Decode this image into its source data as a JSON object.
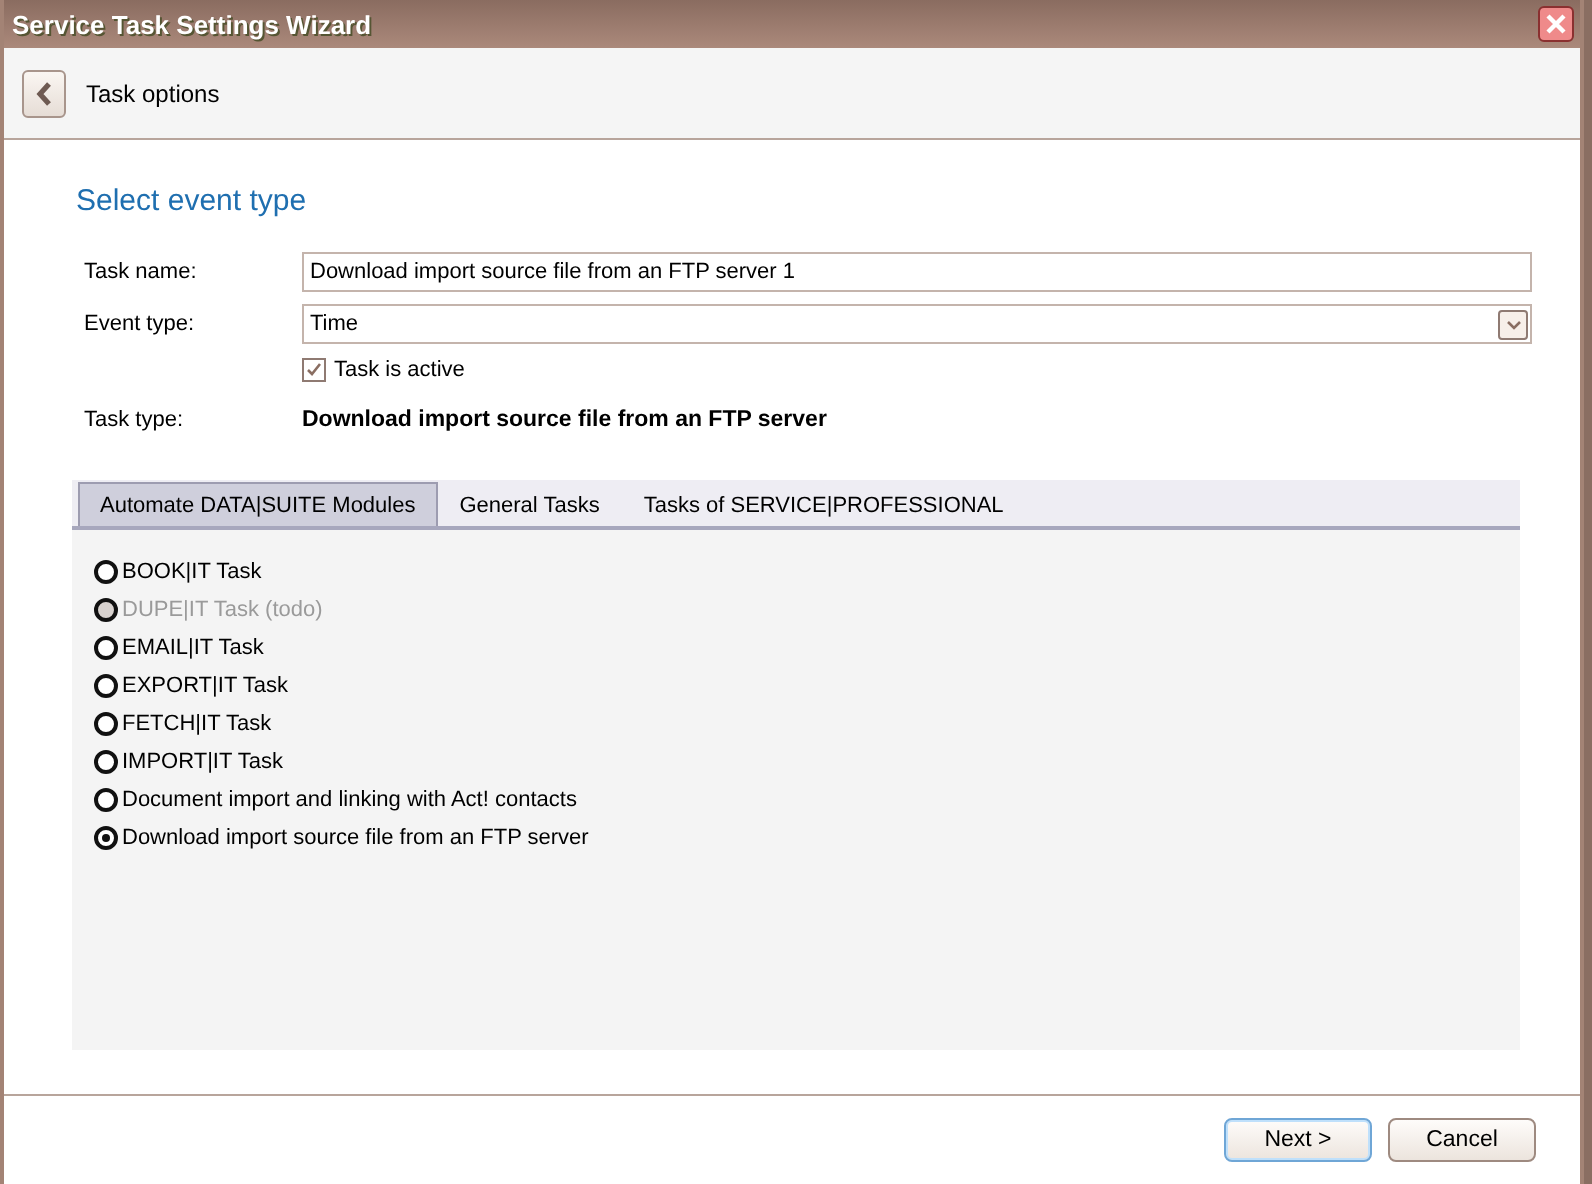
{
  "window": {
    "title": "Service Task Settings Wizard"
  },
  "header": {
    "title": "Task options"
  },
  "heading": "Select event type",
  "form": {
    "task_name": {
      "label": "Task name:",
      "value": "Download import source file from an FTP server 1"
    },
    "event_type": {
      "label": "Event type:",
      "value": "Time"
    },
    "active": {
      "label": "Task is active",
      "checked": true
    },
    "task_type": {
      "label": "Task type:",
      "value": "Download import source file from an FTP server"
    }
  },
  "tabs": [
    {
      "label": "Automate DATA|SUITE Modules",
      "selected": true
    },
    {
      "label": "General Tasks",
      "selected": false
    },
    {
      "label": "Tasks of SERVICE|PROFESSIONAL",
      "selected": false
    }
  ],
  "options": [
    {
      "label": "BOOK|IT Task",
      "selected": false,
      "disabled": false
    },
    {
      "label": "DUPE|IT Task (todo)",
      "selected": false,
      "disabled": true
    },
    {
      "label": "EMAIL|IT Task",
      "selected": false,
      "disabled": false
    },
    {
      "label": "EXPORT|IT Task",
      "selected": false,
      "disabled": false
    },
    {
      "label": "FETCH|IT Task",
      "selected": false,
      "disabled": false
    },
    {
      "label": "IMPORT|IT Task",
      "selected": false,
      "disabled": false
    },
    {
      "label": "Document import and linking with Act! contacts",
      "selected": false,
      "disabled": false
    },
    {
      "label": "Download import source file from an FTP server",
      "selected": true,
      "disabled": false
    }
  ],
  "buttons": [
    {
      "label": "Next >",
      "kind": "default"
    },
    {
      "label": "Cancel",
      "kind": "normal"
    }
  ]
}
